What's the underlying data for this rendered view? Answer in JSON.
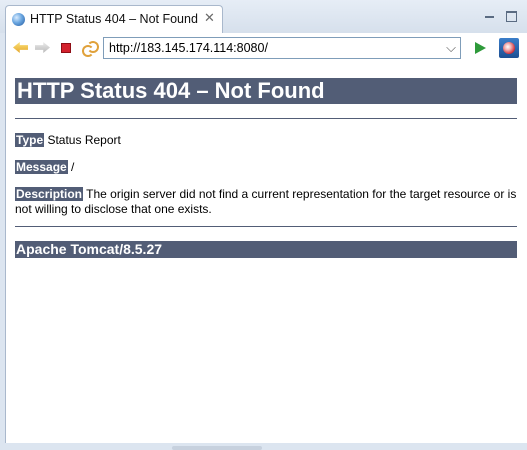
{
  "tab": {
    "title": "HTTP Status 404 – Not Found",
    "close_icon": "✕"
  },
  "window": {
    "minimize_icon": "minimize-icon",
    "maximize_icon": "maximize-icon"
  },
  "toolbar": {
    "url": "http://183.145.174.114:8080/",
    "dropdown_glyph": "⌵",
    "icons": [
      "back-arrow-icon",
      "forward-arrow-icon",
      "stop-icon",
      "refresh-icon",
      "go-icon",
      "browser-icon"
    ]
  },
  "page": {
    "heading": "HTTP Status 404 – Not Found",
    "type_label": "Type",
    "type_value": " Status Report",
    "message_label": "Message",
    "message_value": " /",
    "description_label": "Description",
    "description_value": " The origin server did not find a current representation for the target resource or is not willing to disclose that one exists.",
    "server": "Apache Tomcat/8.5.27"
  },
  "colors": {
    "tomcat_header": "#525d76",
    "chrome_background": "#dce5f0",
    "go_green": "#2e9a3a",
    "stop_red": "#d3212d"
  }
}
